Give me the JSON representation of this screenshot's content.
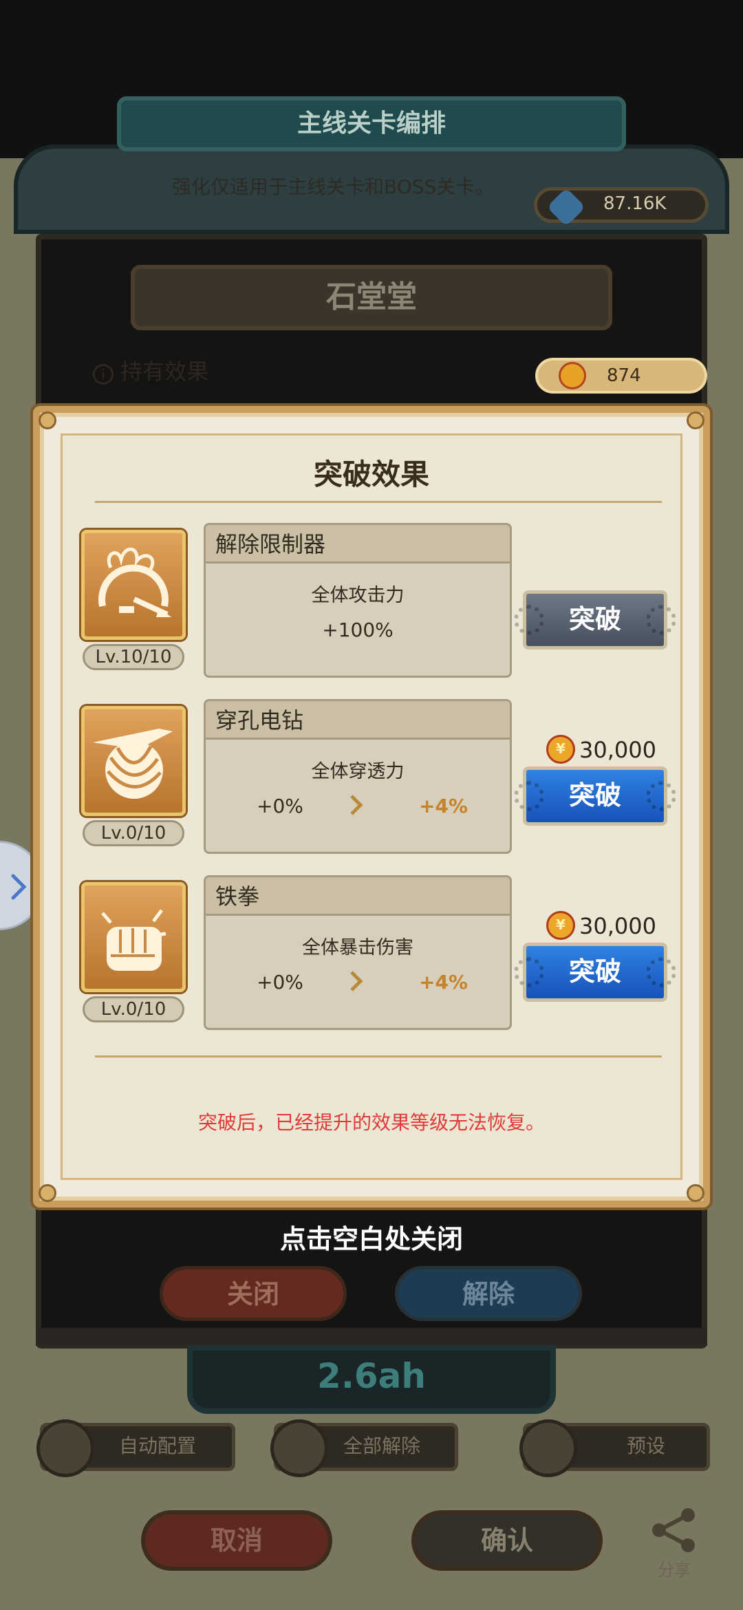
{
  "background": {
    "title": "主线关卡编排",
    "subtitle": "强化仅适用于主线关卡和BOSS关卡。",
    "crystal_amount": "87.16K",
    "stage_name": "石堂堂",
    "held_effect_label": "持有效果",
    "coin_amount": "874",
    "timer": "2.6ah",
    "close_button": "关闭",
    "release_button": "解除",
    "auto_config": "自动配置",
    "release_all": "全部解除",
    "preset": "预设",
    "cancel": "取消",
    "confirm": "确认",
    "share": "分享"
  },
  "modal": {
    "title": "突破效果",
    "rows": [
      {
        "name": "解除限制器",
        "icon": "speedometer-flame-icon",
        "level": "Lv.10/10",
        "description": "全体攻击力",
        "value": "+100%",
        "button": "突破",
        "button_state": "disabled"
      },
      {
        "name": "穿孔电钻",
        "icon": "drill-icon",
        "level": "Lv.0/10",
        "description": "全体穿透力",
        "current": "+0%",
        "next": "+4%",
        "cost": "30,000",
        "button": "突破",
        "button_state": "active"
      },
      {
        "name": "铁拳",
        "icon": "iron-fist-icon",
        "level": "Lv.0/10",
        "description": "全体暴击伤害",
        "current": "+0%",
        "next": "+4%",
        "cost": "30,000",
        "button": "突破",
        "button_state": "active"
      }
    ],
    "warning": "突破后，已经提升的效果等级无法恢复。"
  },
  "close_hint": "点击空白处关闭",
  "colors": {
    "accent_gold": "#c99d5c",
    "active_button": "#2f82e0",
    "warning_red": "#e23a37",
    "next_value": "#c5832b"
  }
}
